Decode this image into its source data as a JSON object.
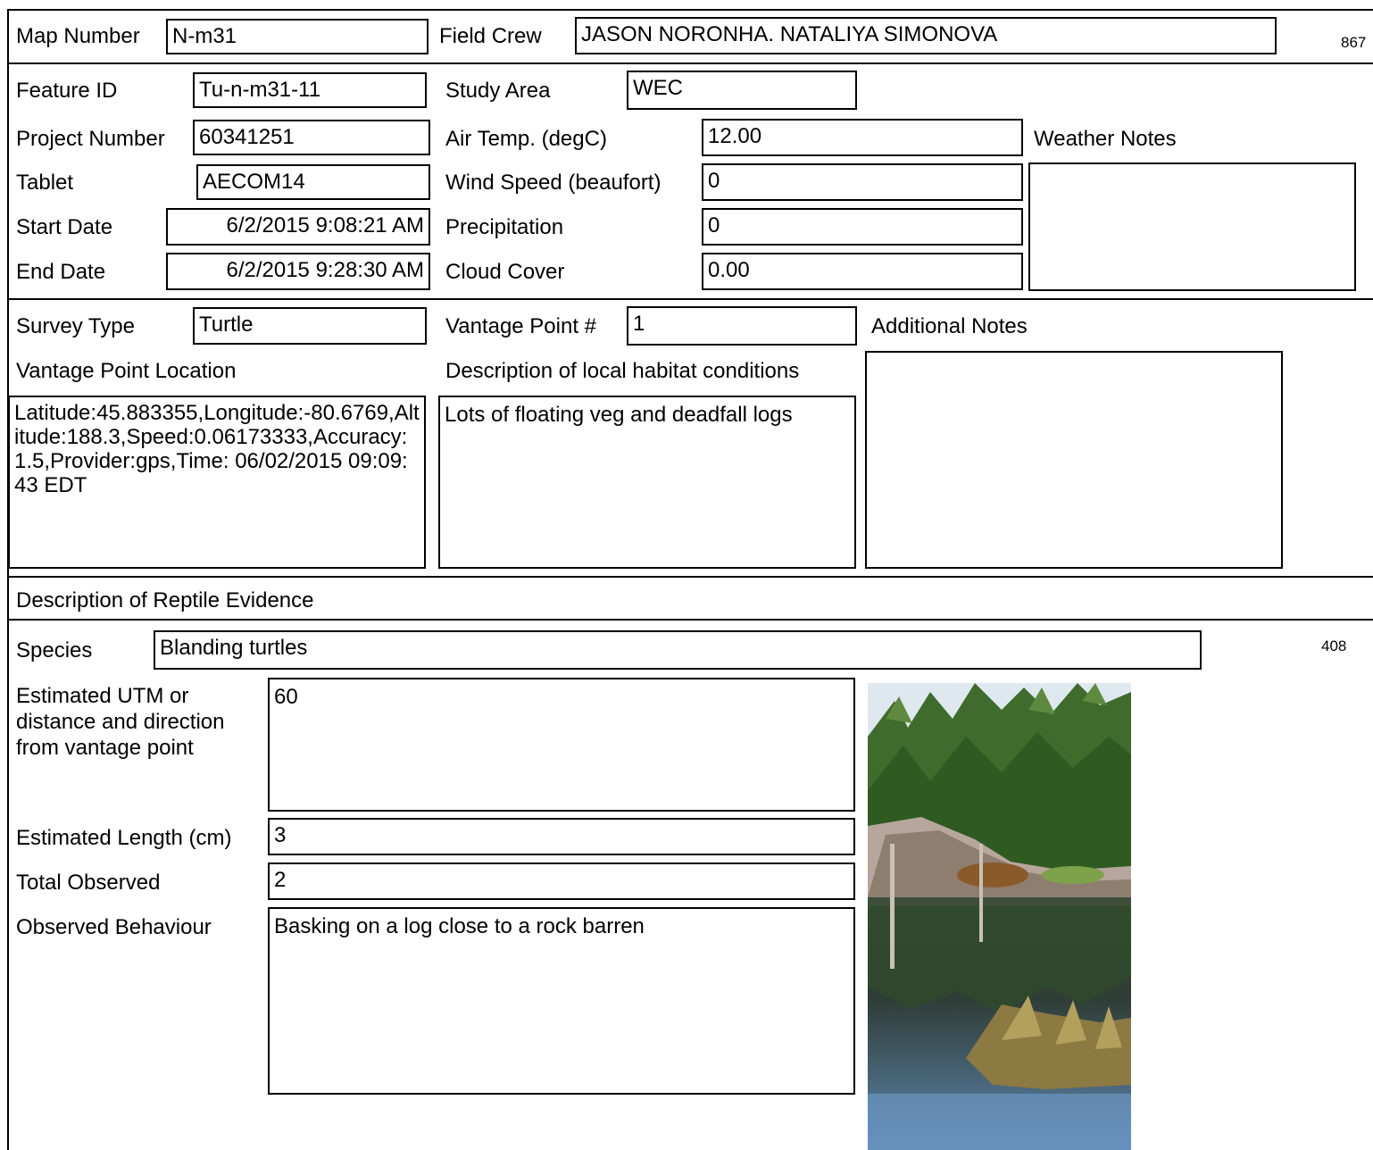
{
  "header": {
    "map_number_label": "Map Number",
    "map_number": "N-m31",
    "field_crew_label": "Field Crew",
    "field_crew": "JASON NORONHA. NATALIYA SIMONOVA",
    "page_code": "867"
  },
  "record": {
    "feature_id_label": "Feature ID",
    "feature_id": "Tu-n-m31-11",
    "project_number_label": "Project Number",
    "project_number": "60341251",
    "tablet_label": "Tablet",
    "tablet": "AECOM14",
    "start_date_label": "Start Date",
    "start_date": "6/2/2015 9:08:21 AM",
    "end_date_label": "End Date",
    "end_date": "6/2/2015 9:28:30 AM",
    "study_area_label": "Study Area",
    "study_area": "WEC",
    "air_temp_label": "Air Temp. (degC)",
    "air_temp": "12.00",
    "wind_speed_label": "Wind Speed (beaufort)",
    "wind_speed": "0",
    "precipitation_label": "Precipitation",
    "precipitation": "0",
    "cloud_cover_label": "Cloud Cover",
    "cloud_cover": "0.00",
    "weather_notes_label": "Weather Notes",
    "weather_notes": ""
  },
  "survey": {
    "survey_type_label": "Survey Type",
    "survey_type": "Turtle",
    "vantage_point_label": "Vantage Point #",
    "vantage_point": "1",
    "additional_notes_label": "Additional Notes",
    "additional_notes": "",
    "vantage_location_label": "Vantage Point Location",
    "vantage_location": "Latitude:45.883355,Longitude:-80.6769,Altitude:188.3,Speed:0.06173333,Accuracy:1.5,Provider:gps,Time: 06/02/2015 09:09:43 EDT",
    "habitat_label": "Description of local habitat conditions",
    "habitat": "Lots of floating veg and deadfall logs"
  },
  "evidence": {
    "section_title": "Description of Reptile Evidence",
    "species_label": "Species",
    "species": "Blanding turtles",
    "record_code": "408",
    "utm_label": "Estimated UTM or distance and direction from vantage point",
    "utm": "60",
    "length_label": "Estimated Length (cm)",
    "length": "3",
    "total_label": "Total Observed",
    "total": "2",
    "behaviour_label": "Observed Behaviour",
    "behaviour": "Basking on a log close to a rock barren"
  }
}
